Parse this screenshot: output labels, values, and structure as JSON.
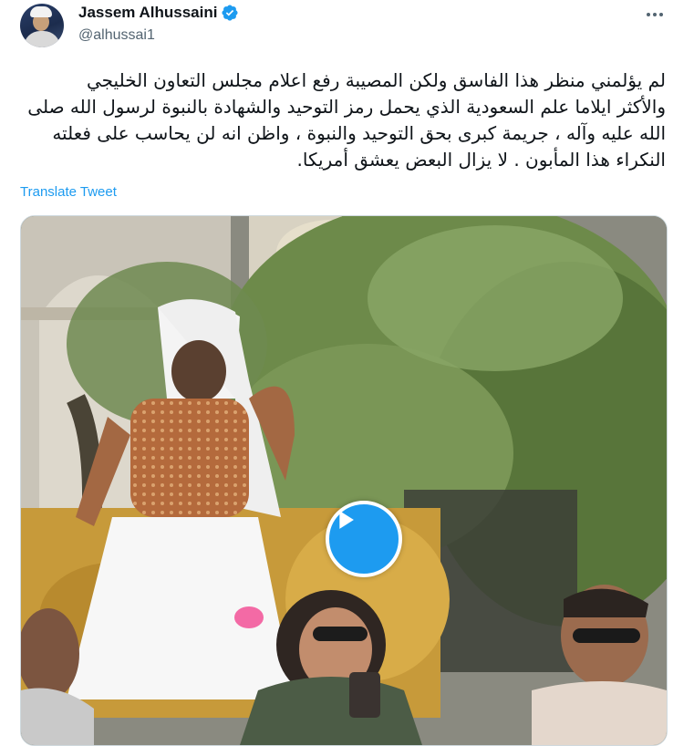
{
  "author": {
    "display_name": "Jassem Alhussaini",
    "handle": "@alhussai1",
    "verified": true
  },
  "tweet": {
    "lines": [
      "لم يؤلمني منظر هذا الفاسق ولكن المصيبة رفع اعلام مجلس التعاون الخليجي",
      "والأكثر ايلاما علم السعودية الذي يحمل رمز التوحيد والشهادة بالنبوة لرسول الله صلى",
      "الله عليه وآله ، جريمة كبرى بحق التوحيد والنبوة ، واظن انه لن يحاسب على فعلته",
      "النكراء هذا المأبون . لا يزال البعض يعشق أمريكا."
    ],
    "translate_label": "Translate Tweet"
  },
  "media": {
    "type": "video",
    "play_icon": "play-icon"
  },
  "icons": {
    "more": "more-options-icon",
    "verified": "verified-badge-icon"
  },
  "colors": {
    "accent": "#1d9bf0",
    "text": "#0f1419",
    "secondary": "#536471"
  }
}
